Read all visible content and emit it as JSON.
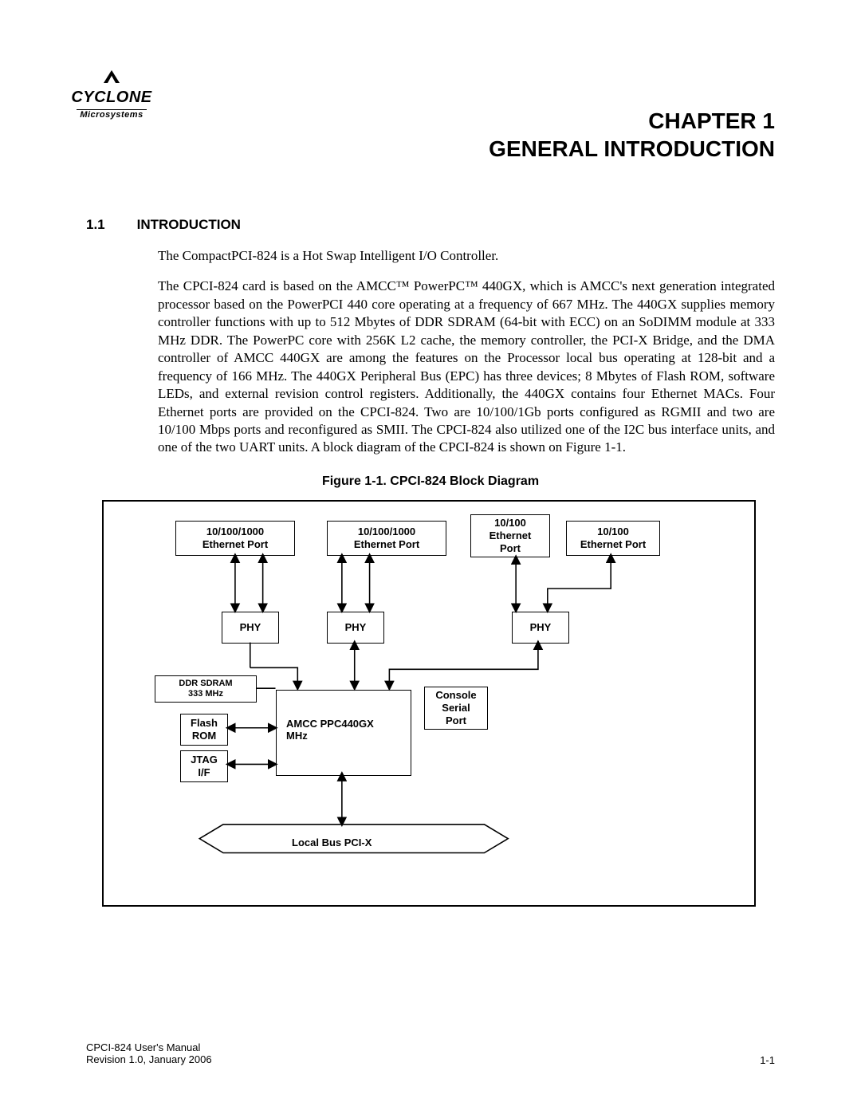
{
  "logo": {
    "name": "CYCLONE",
    "sub": "Microsystems"
  },
  "chapter": {
    "line1": "CHAPTER 1",
    "line2": "GENERAL INTRODUCTION"
  },
  "section": {
    "num": "1.1",
    "title": "INTRODUCTION"
  },
  "para1": "The CompactPCI-824 is a Hot Swap Intelligent I/O Controller.",
  "para2": "The CPCI-824 card is based on the AMCC™ PowerPC™ 440GX, which is AMCC's next generation integrated processor based on the PowerPCI 440 core operating at a frequency of 667 MHz. The 440GX supplies memory controller functions with up to 512 Mbytes of DDR SDRAM (64-bit with ECC) on an SoDIMM module at 333 MHz DDR. The PowerPC core with 256K L2 cache, the memory controller, the PCI-X Bridge, and the DMA controller of AMCC 440GX are among the features on the Processor local bus operating at 128-bit and a frequency of 166 MHz. The 440GX Peripheral Bus (EPC) has three devices; 8 Mbytes of Flash ROM, software LEDs, and external revision control registers. Additionally, the 440GX contains four Ethernet MACs. Four Ethernet ports are provided on the CPCI-824. Two are 10/100/1Gb ports configured as RGMII and two are 10/100 Mbps ports and reconfigured as SMII. The CPCI-824 also utilized one of the I2C bus interface units, and one of the two UART units. A block diagram of the CPCI-824 is shown on Figure 1-1.",
  "figure_caption": "Figure 1-1.  CPCI-824 Block Diagram",
  "diagram": {
    "eth_gig": "10/100/1000\nEthernet Port",
    "eth_100a": "10/100\nEthernet\nPort",
    "eth_100b": "10/100\nEthernet Port",
    "phy": "PHY",
    "ddr": "DDR SDRAM\n333 MHz",
    "flash": "Flash\nROM",
    "jtag": "JTAG\nI/F",
    "cpu": "AMCC PPC440GX\nMHz",
    "console": "Console\nSerial\nPort",
    "bus": "Local Bus PCI-X"
  },
  "footer": {
    "manual": "CPCI-824 User's Manual",
    "rev": "Revision 1.0, January 2006",
    "page": "1-1"
  }
}
